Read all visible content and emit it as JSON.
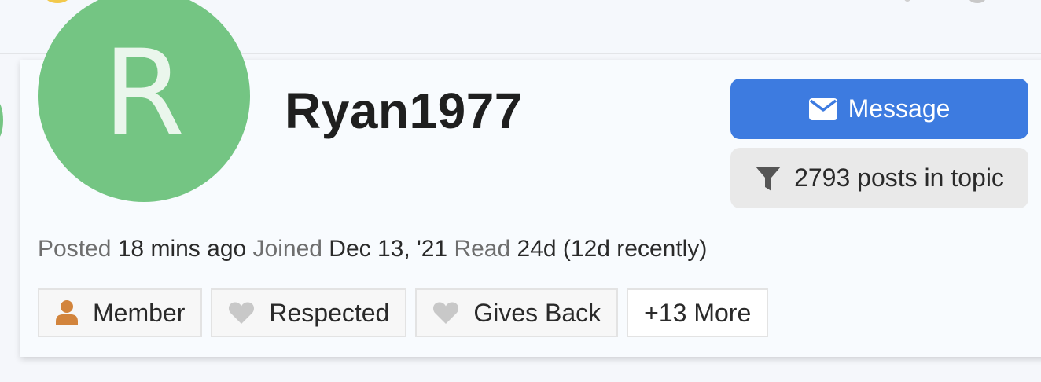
{
  "user": {
    "initial": "R",
    "username": "Ryan1977",
    "avatar_color": "#74c583"
  },
  "actions": {
    "message_label": "Message",
    "message_icon": "envelope-icon",
    "posts_label": "2793 posts in topic",
    "posts_icon": "filter-icon",
    "accent": "#3d7be0"
  },
  "meta": {
    "posted_label": "Posted",
    "posted_value": "18 mins ago",
    "joined_label": "Joined",
    "joined_value": "Dec 13, '21",
    "read_label": "Read",
    "read_value": "24d (12d recently)"
  },
  "badges": [
    {
      "label": "Member",
      "icon": "person-icon"
    },
    {
      "label": "Respected",
      "icon": "heart-icon"
    },
    {
      "label": "Gives Back",
      "icon": "heart-icon"
    },
    {
      "label": "+13 More"
    }
  ]
}
